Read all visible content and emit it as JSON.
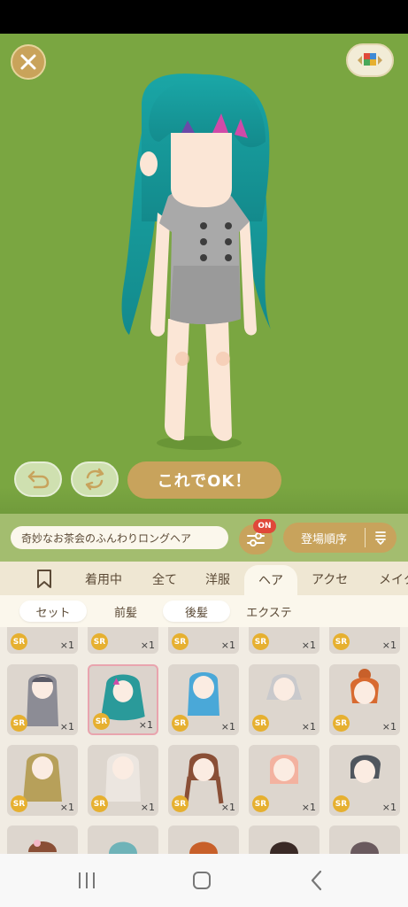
{
  "stage": {
    "ok_label": "これでOK！"
  },
  "info": {
    "item_name": "奇妙なお茶会のふんわりロングヘア",
    "filter_badge": "ON",
    "sort_label": "登場順序"
  },
  "tabs": [
    {
      "label": "着用中"
    },
    {
      "label": "全て"
    },
    {
      "label": "洋服"
    },
    {
      "label": "ヘア"
    },
    {
      "label": "アクセ"
    },
    {
      "label": "メイク"
    }
  ],
  "subtabs": [
    {
      "label": "セット"
    },
    {
      "label": "前髪"
    },
    {
      "label": "後髪"
    },
    {
      "label": "エクステ"
    }
  ],
  "items": {
    "rarity": "SR",
    "count": "×1"
  },
  "colors": {
    "stage_bg": "#7aa641",
    "accent_gold": "#c8a35c",
    "selected_border": "#e9a4ae",
    "badge_red": "#e0483a"
  }
}
